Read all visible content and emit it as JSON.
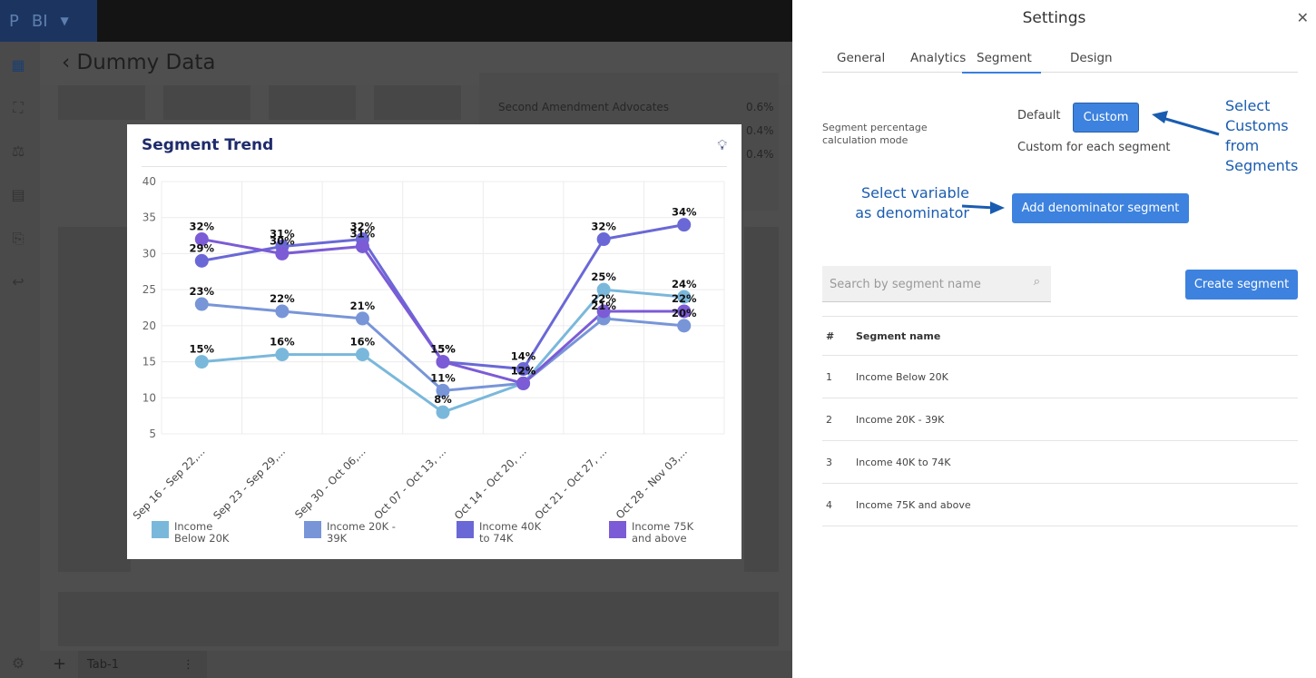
{
  "app": {
    "logo": "P",
    "name": "BI",
    "page_title": "Dummy Data",
    "tab": "Tab-1"
  },
  "background_list": [
    {
      "label": "Second Amendment Advocates",
      "value": "0.6%"
    },
    {
      "label": "",
      "value": "0.4%"
    },
    {
      "label": "",
      "value": "0.4%"
    }
  ],
  "card": {
    "title": "Segment Trend"
  },
  "chart_data": {
    "type": "line",
    "title": "Segment Trend",
    "categories": [
      "Sep 16 - Sep 22,...",
      "Sep 23 - Sep 29,...",
      "Sep 30 - Oct 06,...",
      "Oct 07 - Oct 13, ...",
      "Oct 14 - Oct 20, ...",
      "Oct 21 - Oct 27, ...",
      "Oct 28 - Nov 03,..."
    ],
    "ylim": [
      5,
      40
    ],
    "yticks": [
      5,
      10,
      15,
      20,
      25,
      30,
      35,
      40
    ],
    "grid": true,
    "legend": "bottom",
    "series": [
      {
        "name": "Income Below 20K",
        "color": "#7ab8db",
        "values": [
          15,
          16,
          16,
          8,
          12,
          25,
          24
        ]
      },
      {
        "name": "Income 20K - 39K",
        "color": "#7895d8",
        "values": [
          23,
          22,
          21,
          11,
          12,
          21,
          20
        ]
      },
      {
        "name": "Income 40K to 74K",
        "color": "#6a68d6",
        "values": [
          29,
          31,
          32,
          15,
          14,
          32,
          34
        ]
      },
      {
        "name": "Income 75K and above",
        "color": "#7c5bd6",
        "values": [
          32,
          30,
          31,
          15,
          12,
          22,
          22
        ]
      }
    ]
  },
  "settings": {
    "title": "Settings",
    "tabs": [
      "General",
      "Analytics",
      "Segment",
      "Design"
    ],
    "active_tab": "Segment",
    "mode_label": "Segment percentage calculation mode",
    "default_label": "Default",
    "custom_button": "Custom",
    "custom_desc": "Custom for each segment",
    "add_denominator": "Add denominator segment",
    "search_placeholder": "Search by segment name",
    "create_segment": "Create segment",
    "table_headers": [
      "#",
      "Segment name"
    ],
    "segments": [
      {
        "n": "1",
        "name": "Income Below 20K"
      },
      {
        "n": "2",
        "name": "Income 20K - 39K"
      },
      {
        "n": "3",
        "name": "Income 40K to 74K"
      },
      {
        "n": "4",
        "name": "Income 75K and above"
      }
    ]
  },
  "annotations": {
    "custom": "Select Customs from Segments",
    "denominator": "Select variable as denominator"
  }
}
